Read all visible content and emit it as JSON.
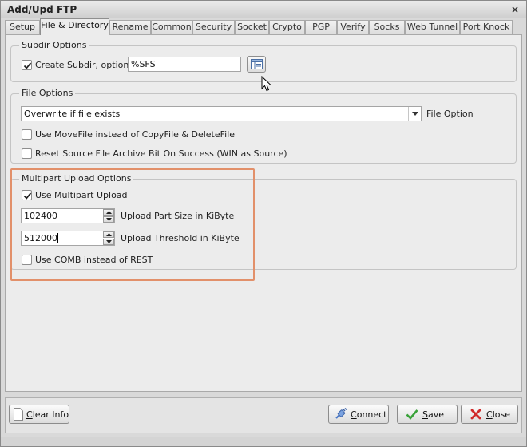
{
  "window": {
    "title": "Add/Upd FTP",
    "close_glyph": "×"
  },
  "tabs": [
    {
      "label": "Setup"
    },
    {
      "label": "File & Directory",
      "active": true
    },
    {
      "label": "Rename"
    },
    {
      "label": "Common"
    },
    {
      "label": "Security"
    },
    {
      "label": "Socket"
    },
    {
      "label": "Crypto"
    },
    {
      "label": "PGP"
    },
    {
      "label": "Verify"
    },
    {
      "label": "Socks"
    },
    {
      "label": "Web Tunnel"
    },
    {
      "label": "Port Knock"
    }
  ],
  "subdir_options": {
    "title": "Subdir Options",
    "create_subdir": {
      "label": "Create Subdir, option",
      "checked": true
    },
    "subdir_value": "%SFS",
    "browse_icon": "list-icon"
  },
  "file_options": {
    "title": "File Options",
    "overwrite_combo": {
      "value": "Overwrite if file exists",
      "label": "File Option"
    },
    "use_movefile": {
      "label": "Use MoveFile instead of CopyFile & DeleteFile",
      "checked": false
    },
    "reset_archive": {
      "label": "Reset Source File Archive Bit On Success (WIN as Source)",
      "checked": false
    }
  },
  "multipart": {
    "title": "Multipart Upload Options",
    "use_multipart": {
      "label": "Use Multipart Upload",
      "checked": true
    },
    "part_size": {
      "value": "102400",
      "label": "Upload Part Size in KiByte"
    },
    "threshold": {
      "value": "512000",
      "label": "Upload Threshold in KiByte"
    },
    "use_comb": {
      "label": "Use COMB instead of REST",
      "checked": false
    }
  },
  "buttons": {
    "clear_info": {
      "prefix": "",
      "accel": "C",
      "rest": "lear Info"
    },
    "connect": {
      "prefix": "",
      "accel": "C",
      "rest": "onnect"
    },
    "save": {
      "prefix": "",
      "accel": "S",
      "rest": "ave"
    },
    "close": {
      "prefix": "",
      "accel": "C",
      "rest": "lose"
    }
  },
  "colors": {
    "highlight": "#e2906a",
    "check": "#222222",
    "save_icon": "#3aa23a",
    "close_icon": "#d12b2b",
    "connect_icon": "#4a78c8"
  }
}
